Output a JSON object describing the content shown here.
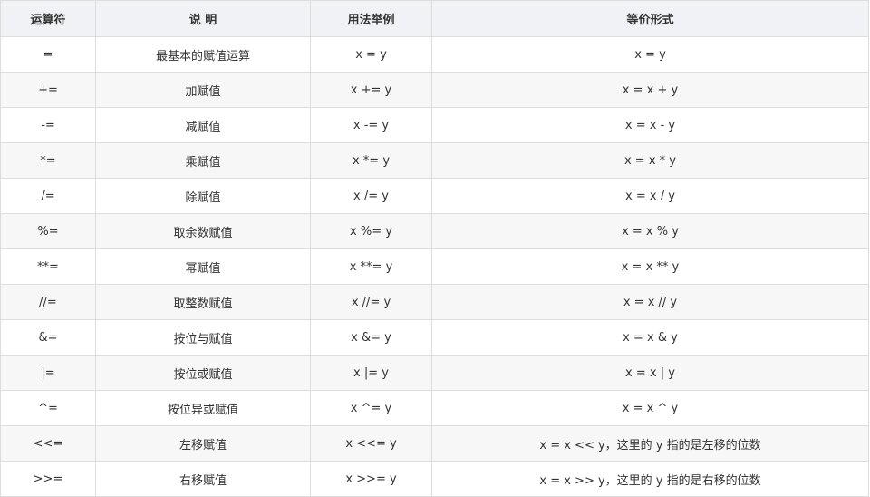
{
  "table": {
    "headers": [
      "运算符",
      "说 明",
      "用法举例",
      "等价形式"
    ],
    "rows": [
      [
        "=",
        "最基本的赋值运算",
        "x = y",
        "x = y"
      ],
      [
        "+=",
        "加赋值",
        "x += y",
        "x = x + y"
      ],
      [
        "-=",
        "减赋值",
        "x -= y",
        "x = x - y"
      ],
      [
        "*=",
        "乘赋值",
        "x *= y",
        "x = x * y"
      ],
      [
        "/=",
        "除赋值",
        "x /= y",
        "x = x / y"
      ],
      [
        "%=",
        "取余数赋值",
        "x %= y",
        "x = x % y"
      ],
      [
        "**=",
        "幂赋值",
        "x **= y",
        "x = x ** y"
      ],
      [
        "//=",
        "取整数赋值",
        "x //= y",
        "x = x // y"
      ],
      [
        "&=",
        "按位与赋值",
        "x &= y",
        "x = x & y"
      ],
      [
        "|=",
        "按位或赋值",
        "x |= y",
        "x = x | y"
      ],
      [
        "^=",
        "按位异或赋值",
        "x ^= y",
        "x = x ^ y"
      ],
      [
        "<<=",
        "左移赋值",
        "x <<= y",
        "x = x << y，这里的 y 指的是左移的位数"
      ],
      [
        ">>=",
        "右移赋值",
        "x >>= y",
        "x = x >> y，这里的 y 指的是右移的位数"
      ]
    ]
  }
}
